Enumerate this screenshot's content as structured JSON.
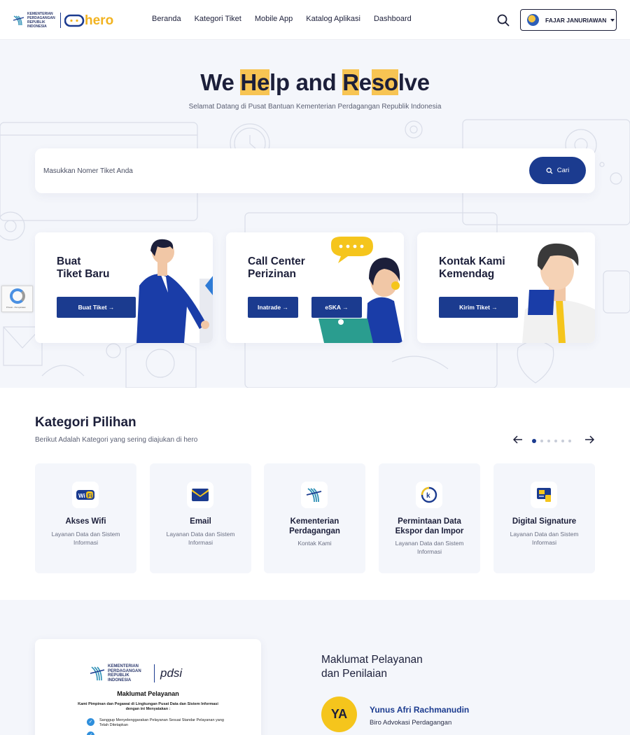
{
  "header": {
    "logo_ministry": "KEMENTERIAN PERDAGANGAN REPUBLIK INDONESIA",
    "logo_brand": "hero",
    "nav": [
      "Beranda",
      "Kategori Tiket",
      "Mobile App",
      "Katalog Aplikasi",
      "Dashboard"
    ],
    "user_name": "FAJAR JANURIAWAN"
  },
  "hero": {
    "title_parts": [
      "We ",
      "He",
      "lp and ",
      "R",
      "e",
      "so",
      "lve"
    ],
    "subtitle": "Selamat Datang di Pusat Bantuan Kementerian Perdagangan Republik Indonesia",
    "search_placeholder": "Masukkan Nomer Tiket Anda",
    "search_button": "Cari"
  },
  "cards": [
    {
      "title": "Buat\nTiket Baru",
      "buttons": [
        "Buat Tiket →"
      ]
    },
    {
      "title": "Call Center\nPerizinan",
      "buttons": [
        "Inatrade →",
        "eSKA →"
      ]
    },
    {
      "title": "Kontak Kami\nKemendag",
      "buttons": [
        "Kirim Tiket →"
      ]
    }
  ],
  "recaptcha_text": "Privasi - Persyaratan",
  "kategori": {
    "title": "Kategori Pilihan",
    "subtitle": "Berikut Adalah Kategori yang sering diajukan di hero",
    "items": [
      {
        "name": "Akses Wifi",
        "desc": "Layanan Data dan Sistem Informasi",
        "icon": "wifi-icon"
      },
      {
        "name": "Email",
        "desc": "Layanan Data dan Sistem Informasi",
        "icon": "email-icon"
      },
      {
        "name": "Kementerian Perdagangan",
        "desc": "Kontak Kami",
        "icon": "kemendag-icon"
      },
      {
        "name": "Permintaan Data Ekspor dan Impor",
        "desc": "Layanan Data dan Sistem Informasi",
        "icon": "data-icon"
      },
      {
        "name": "Digital Signature",
        "desc": "Layanan Data dan Sistem Informasi",
        "icon": "signature-icon"
      }
    ]
  },
  "maklumat": {
    "doc_ministry": "KEMENTERIAN PERDAGANGAN REPUBLIK INDONESIA",
    "doc_brand": "pdsi",
    "doc_title": "Maklumat Pelayanan",
    "doc_intro": "Kami Pimpinan dan Pegawai di Lingkungan Pusat Data dan Sistem Informasi dengan ini Menyatakan :",
    "doc_items": [
      "Sanggup Menyelenggarakan Pelayanan Sesuai Standar Pelayanan yang Telah Ditetapkan"
    ],
    "title": "Maklumat Pelayanan\ndan Penilaian",
    "initials": "YA",
    "person_name": "Yunus Afri Rachmanudin",
    "person_role": "Biro Advokasi Perdagangan"
  },
  "colors": {
    "primary": "#1b3b8f",
    "accent": "#f7c453",
    "background": "#f4f6fb"
  }
}
